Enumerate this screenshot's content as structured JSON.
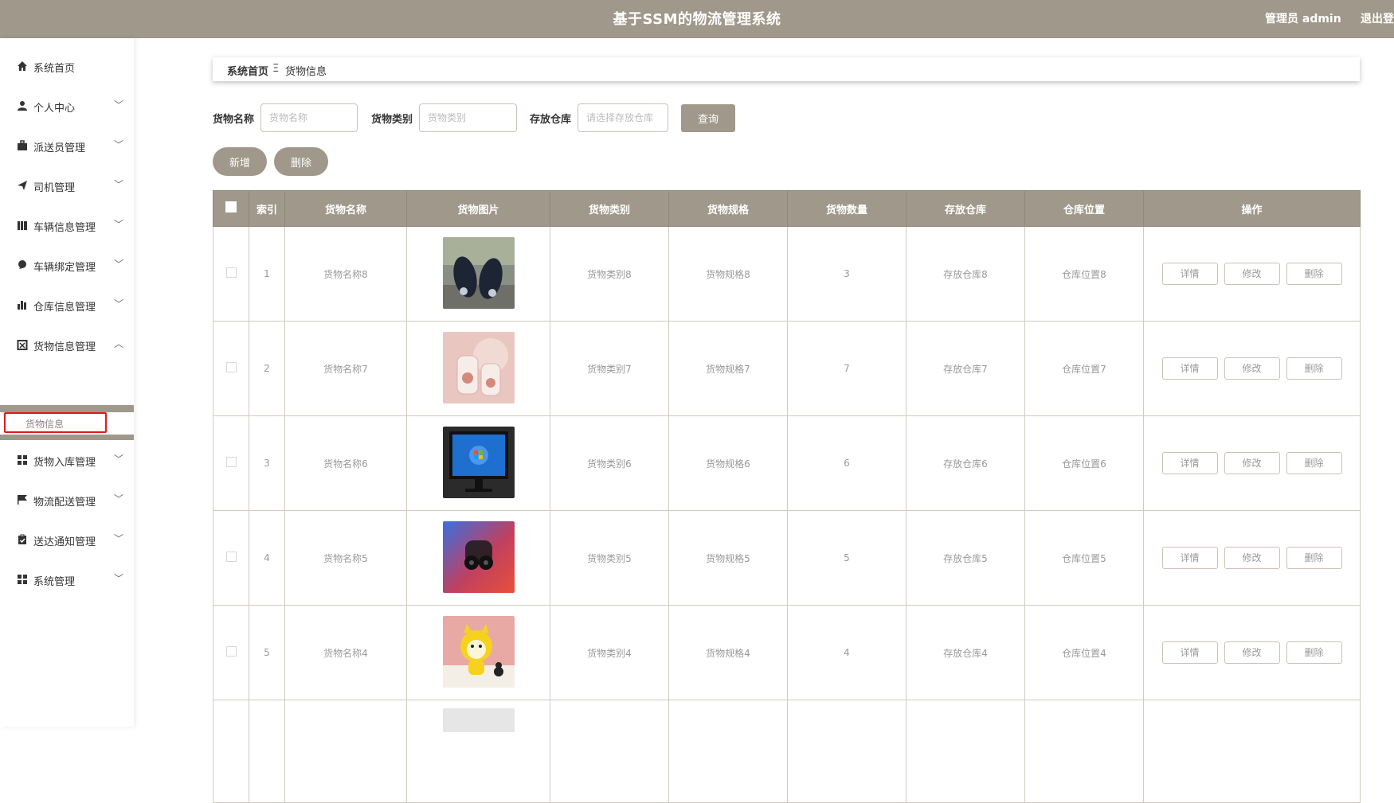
{
  "app": {
    "title": "基于SSM的物流管理系统",
    "user": "管理员 admin",
    "logout": "退出登"
  },
  "sidebar": {
    "items": [
      {
        "label": "系统首页",
        "icon": "home-icon",
        "chevron": ""
      },
      {
        "label": "个人中心",
        "icon": "user-icon",
        "chevron": "﹀"
      },
      {
        "label": "派送员管理",
        "icon": "briefcase-icon",
        "chevron": "﹀"
      },
      {
        "label": "司机管理",
        "icon": "paper-plane-icon",
        "chevron": "﹀"
      },
      {
        "label": "车辆信息管理",
        "icon": "bar-list-icon",
        "chevron": "﹀"
      },
      {
        "label": "车辆绑定管理",
        "icon": "pin-icon",
        "chevron": "﹀"
      },
      {
        "label": "仓库信息管理",
        "icon": "bar-chart-icon",
        "chevron": "﹀"
      },
      {
        "label": "货物信息管理",
        "icon": "box-icon",
        "chevron": "︿"
      },
      {
        "label": "货物入库管理",
        "icon": "grid-icon",
        "chevron": "﹀"
      },
      {
        "label": "物流配送管理",
        "icon": "flag-icon",
        "chevron": "﹀"
      },
      {
        "label": "送达通知管理",
        "icon": "clipboard-icon",
        "chevron": "﹀"
      },
      {
        "label": "系统管理",
        "icon": "grid-icon",
        "chevron": "﹀"
      }
    ],
    "submenu": {
      "label": "货物信息"
    }
  },
  "breadcrumb": {
    "home": "系统首页",
    "separator": "Ξ",
    "current": "货物信息"
  },
  "search": {
    "name_label": "货物名称",
    "name_placeholder": "货物名称",
    "category_label": "货物类别",
    "category_placeholder": "货物类别",
    "warehouse_label": "存放仓库",
    "warehouse_placeholder": "请选择存放仓库",
    "query_button": "查询"
  },
  "actions": {
    "add": "新增",
    "delete": "删除"
  },
  "table": {
    "headers": [
      "索引",
      "货物名称",
      "货物图片",
      "货物类别",
      "货物规格",
      "货物数量",
      "存放仓库",
      "仓库位置",
      "操作"
    ],
    "rows": [
      {
        "index": "1",
        "name": "货物名称8",
        "image": "shoes",
        "category": "货物类别8",
        "spec": "货物规格8",
        "qty": "3",
        "warehouse": "存放仓库8",
        "location": "仓库位置8"
      },
      {
        "index": "2",
        "name": "货物名称7",
        "image": "bottles",
        "category": "货物类别7",
        "spec": "货物规格7",
        "qty": "7",
        "warehouse": "存放仓库7",
        "location": "仓库位置7"
      },
      {
        "index": "3",
        "name": "货物名称6",
        "image": "monitor",
        "category": "货物类别6",
        "spec": "货物规格6",
        "qty": "6",
        "warehouse": "存放仓库6",
        "location": "仓库位置6"
      },
      {
        "index": "4",
        "name": "货物名称5",
        "image": "earbuds",
        "category": "货物类别5",
        "spec": "货物规格5",
        "qty": "5",
        "warehouse": "存放仓库5",
        "location": "仓库位置5"
      },
      {
        "index": "5",
        "name": "货物名称4",
        "image": "toy",
        "category": "货物类别4",
        "spec": "货物规格4",
        "qty": "4",
        "warehouse": "存放仓库4",
        "location": "仓库位置4"
      }
    ],
    "row_buttons": {
      "detail": "详情",
      "edit": "修改",
      "delete": "删除"
    }
  },
  "colors": {
    "accent": "#a0988a",
    "highlight_border": "#e0191b"
  }
}
